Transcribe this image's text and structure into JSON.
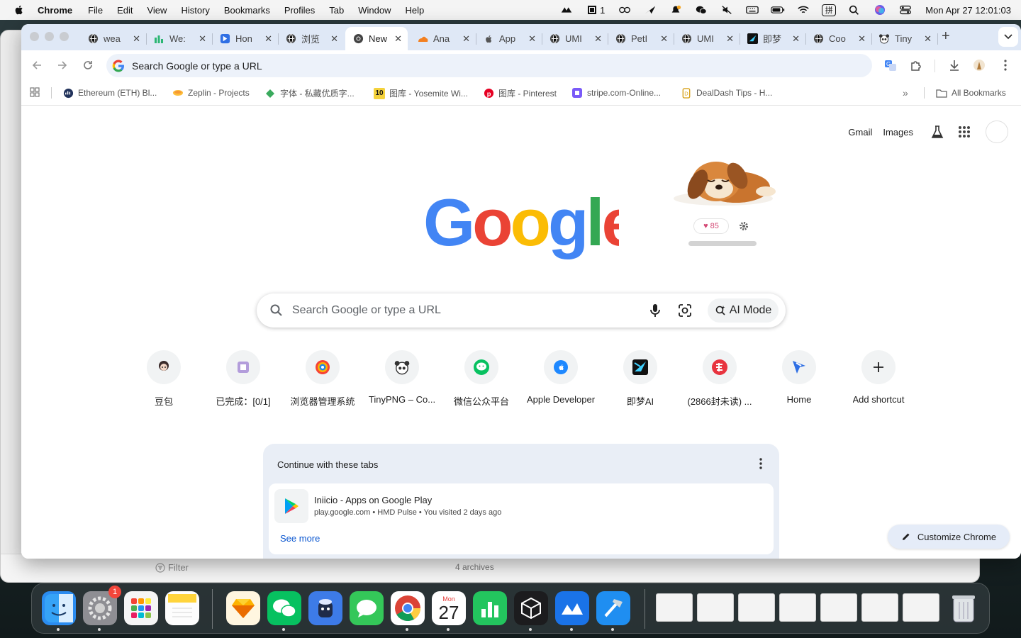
{
  "menubar": {
    "app": "Chrome",
    "items": [
      "File",
      "Edit",
      "View",
      "History",
      "Bookmarks",
      "Profiles",
      "Tab",
      "Window",
      "Help"
    ],
    "status_icons": [
      "cloud-icon",
      "notifications-badge-icon",
      "glasses-icon",
      "send-icon",
      "bell-icon",
      "wechat-icon",
      "mute-icon",
      "keyboard-icon",
      "battery-icon",
      "wifi-icon",
      "input-method-icon",
      "spotlight-icon",
      "siri-icon",
      "control-center-icon"
    ],
    "notif_count": "1",
    "input_method": "拼",
    "clock": "Mon Apr 27  12:01:03"
  },
  "tabs": [
    {
      "title": "wea",
      "icon": "globe-icon"
    },
    {
      "title": "We:",
      "icon": "chart-icon"
    },
    {
      "title": "Hon",
      "icon": "arrow-icon"
    },
    {
      "title": "浏览",
      "icon": "globe-icon"
    },
    {
      "title": "New",
      "icon": "chrome-icon",
      "active": true
    },
    {
      "title": "Ana",
      "icon": "cloudflare-icon"
    },
    {
      "title": "App",
      "icon": "apple-icon"
    },
    {
      "title": "UMI",
      "icon": "globe-icon"
    },
    {
      "title": "PetI",
      "icon": "globe-icon"
    },
    {
      "title": "UMI",
      "icon": "globe-icon"
    },
    {
      "title": "即梦",
      "icon": "jimeng-icon"
    },
    {
      "title": "Coo",
      "icon": "globe-icon"
    },
    {
      "title": "Tiny",
      "icon": "panda-icon"
    }
  ],
  "omnibox": {
    "placeholder": "Search Google or type a URL"
  },
  "bookmarks": [
    {
      "label": "Ethereum (ETH) Bl...",
      "icon": "etherscan-icon"
    },
    {
      "label": "Zeplin - Projects",
      "icon": "zeplin-icon"
    },
    {
      "label": "字体 - 私藏优质字...",
      "icon": "font-icon"
    },
    {
      "label": "图库 - Yosemite Wi...",
      "icon": "ten-icon"
    },
    {
      "label": "图库 - Pinterest",
      "icon": "pinterest-icon"
    },
    {
      "label": "stripe.com-Online...",
      "icon": "stripe-icon"
    },
    {
      "label": "DealDash Tips - H...",
      "icon": "dealdash-icon"
    }
  ],
  "all_bookmarks": "All Bookmarks",
  "ntp": {
    "gmail": "Gmail",
    "images": "Images",
    "doodle_likes": "85",
    "search_placeholder": "Search Google or type a URL",
    "ai_mode": "AI Mode",
    "shortcuts": [
      {
        "label": "豆包",
        "icon": "doubao-icon"
      },
      {
        "label": "已完成：[0/1]",
        "icon": "task-icon"
      },
      {
        "label": "浏览器管理系统",
        "icon": "browser-admin-icon"
      },
      {
        "label": "TinyPNG – Co...",
        "icon": "panda-icon"
      },
      {
        "label": "微信公众平台",
        "icon": "wechat-icon"
      },
      {
        "label": "Apple Developer",
        "icon": "apple-icon"
      },
      {
        "label": "即梦AI",
        "icon": "jimeng-icon"
      },
      {
        "label": "(2866封未读) ...",
        "icon": "mail-163-icon"
      },
      {
        "label": "Home",
        "icon": "home-arrow-icon"
      },
      {
        "label": "Add shortcut",
        "icon": "plus-icon"
      }
    ],
    "continue": {
      "heading": "Continue with these tabs",
      "item_title": "Iniicio - Apps on Google Play",
      "item_meta": "play.google.com • HMD Pulse • You visited 2 days ago",
      "see_more": "See more"
    },
    "customize": "Customize Chrome"
  },
  "background_window": {
    "filter": "Filter",
    "archives": "4 archives"
  },
  "dock": {
    "apps": [
      "finder-icon",
      "system-settings-icon",
      "launchpad-icon",
      "notes-icon",
      "sketch-icon",
      "wechat-icon",
      "cleaner-icon",
      "messages-icon",
      "chrome-icon",
      "calendar-icon",
      "numbers-icon",
      "cube-icon",
      "lanhu-icon",
      "xcode-icon"
    ],
    "settings_badge": "1",
    "calendar_month": "Mon",
    "calendar_day": "27"
  }
}
